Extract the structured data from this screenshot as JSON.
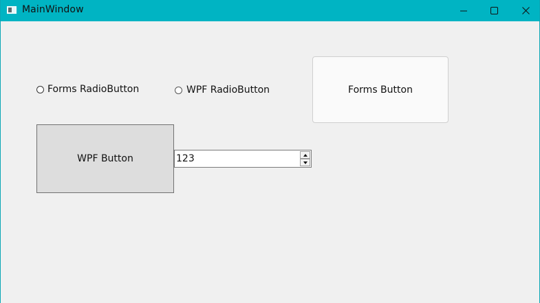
{
  "window": {
    "title": "MainWindow",
    "accent_color": "#00b4c3",
    "controls": {
      "minimize_icon": "minimize-icon",
      "maximize_icon": "maximize-icon",
      "close_icon": "close-icon"
    }
  },
  "content": {
    "forms_radio": {
      "label": "Forms RadioButton",
      "checked": false
    },
    "wpf_radio": {
      "label": "WPF RadioButton",
      "checked": false
    },
    "forms_button": {
      "label": "Forms Button"
    },
    "wpf_button": {
      "label": "WPF Button"
    },
    "numeric_updown": {
      "value": "123"
    }
  }
}
